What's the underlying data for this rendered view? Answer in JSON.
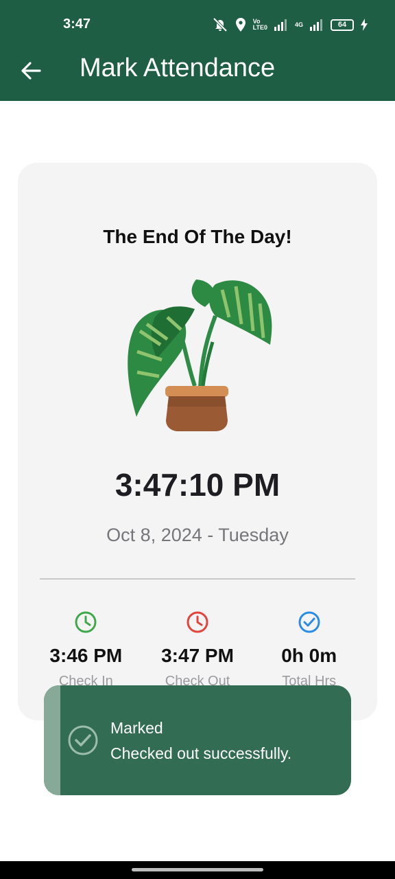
{
  "status_bar": {
    "time": "3:47",
    "volte_top": "Vo",
    "volte_bottom": "LTE0",
    "network": "4G",
    "battery": "64"
  },
  "app_bar": {
    "title": "Mark Attendance"
  },
  "card": {
    "headline": "The End Of The Day!",
    "clock": "3:47:10 PM",
    "date": "Oct 8, 2024 - Tuesday",
    "stats": [
      {
        "icon": "clock-icon",
        "color": "#3ea84a",
        "value": "3:46 PM",
        "label": "Check In"
      },
      {
        "icon": "clock-icon",
        "color": "#e3443b",
        "value": "3:47 PM",
        "label": "Check Out"
      },
      {
        "icon": "check-circle-icon",
        "color": "#2b8ce6",
        "value": "0h 0m",
        "label": "Total Hrs"
      }
    ]
  },
  "toast": {
    "title": "Marked",
    "message": "Checked out successfully."
  },
  "colors": {
    "primary": "#1d5e44",
    "toast_bg": "#326d53",
    "card_bg": "#f4f4f5"
  }
}
